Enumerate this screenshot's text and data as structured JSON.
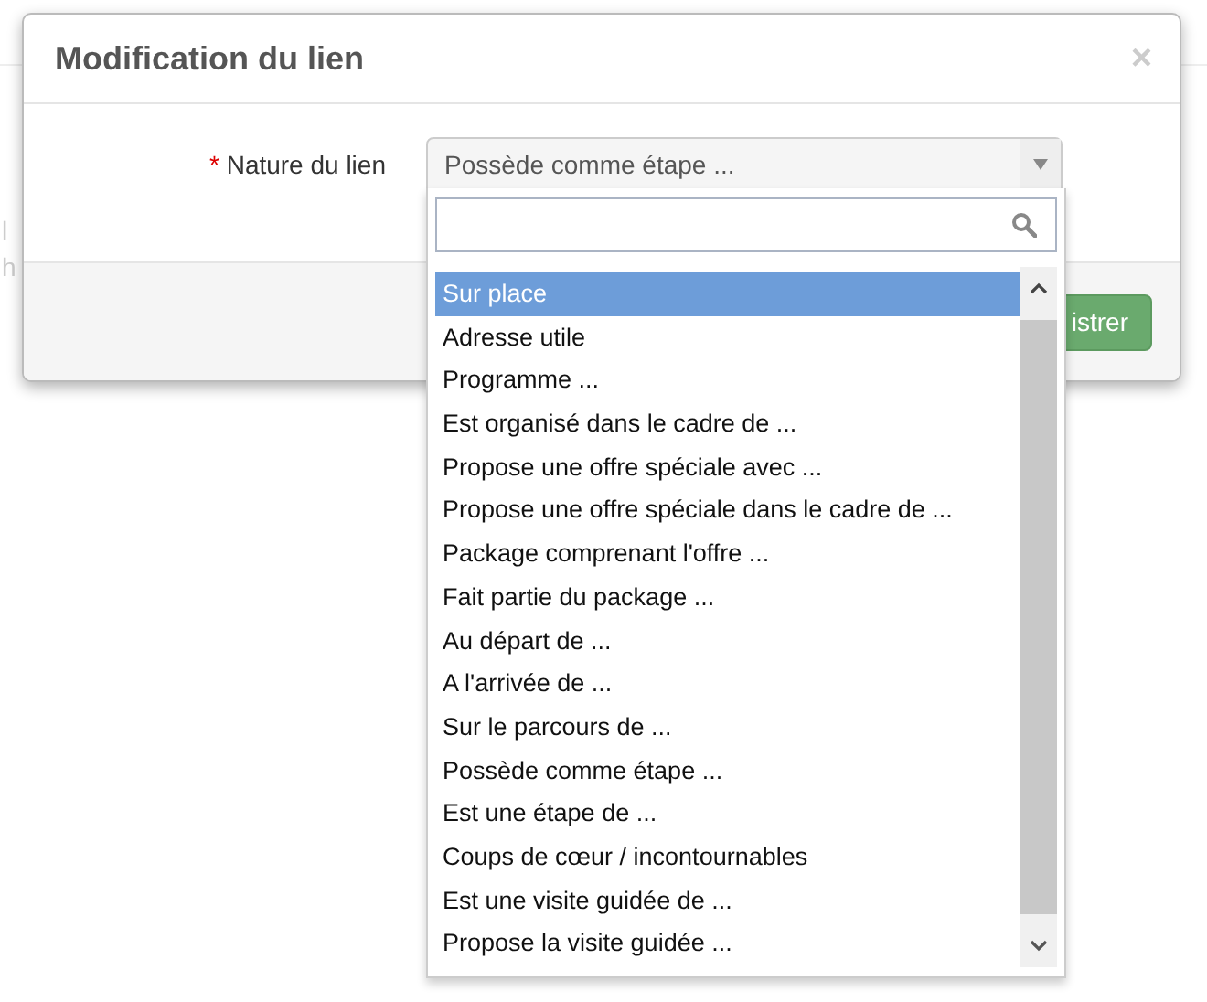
{
  "background_text": [
    "l",
    "h"
  ],
  "modal": {
    "title": "Modification du lien",
    "close": "×",
    "field": {
      "required_mark": "*",
      "label": "Nature du lien",
      "value": "Possède comme étape ...",
      "expanded": true
    },
    "footer_button": "istrer"
  },
  "dropdown": {
    "options": [
      {
        "label": "Sur place",
        "selected": true
      },
      {
        "label": "Adresse utile",
        "selected": false
      },
      {
        "label": "Programme ...",
        "selected": false
      },
      {
        "label": "Est organisé dans le cadre de ...",
        "selected": false
      },
      {
        "label": "Propose une offre spéciale avec ...",
        "selected": false
      },
      {
        "label": "Propose une offre spéciale dans le cadre de ...",
        "selected": false
      },
      {
        "label": "Package comprenant l'offre ...",
        "selected": false
      },
      {
        "label": "Fait partie du package ...",
        "selected": false
      },
      {
        "label": "Au départ de ...",
        "selected": false
      },
      {
        "label": "A l'arrivée de ...",
        "selected": false
      },
      {
        "label": "Sur le parcours de ...",
        "selected": false
      },
      {
        "label": "Possède comme étape ...",
        "selected": false
      },
      {
        "label": "Est une étape de ...",
        "selected": false
      },
      {
        "label": "Coups de cœur / incontournables",
        "selected": false
      },
      {
        "label": "Est une visite guidée de ...",
        "selected": false
      },
      {
        "label": "Propose la visite guidée ...",
        "selected": false
      }
    ]
  }
}
